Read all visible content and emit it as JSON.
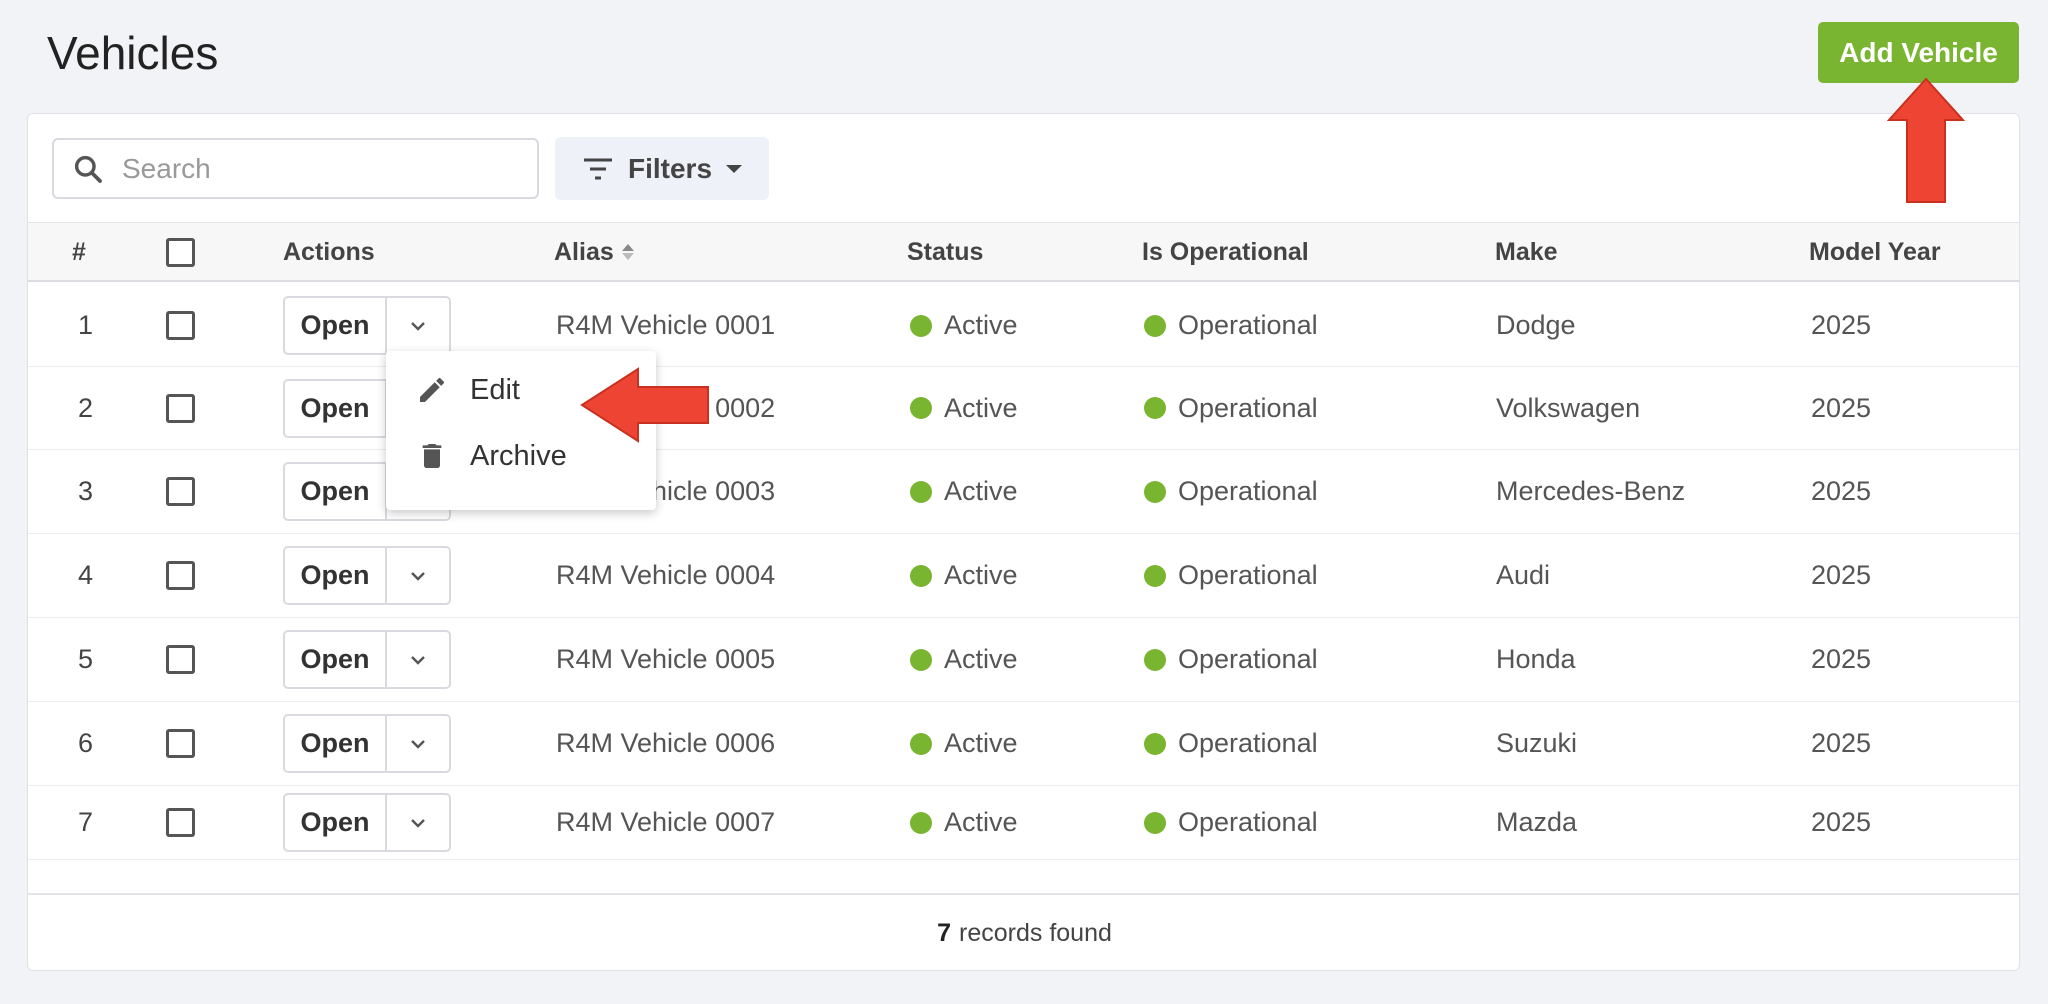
{
  "page": {
    "title": "Vehicles"
  },
  "toolbar": {
    "add_label": "Add Vehicle",
    "search_placeholder": "Search",
    "search_value": "",
    "filters_label": "Filters"
  },
  "table": {
    "headers": {
      "index": "#",
      "actions": "Actions",
      "alias": "Alias",
      "status": "Status",
      "operational": "Is Operational",
      "make": "Make",
      "model_year": "Model Year"
    },
    "rows": [
      {
        "n": "1",
        "alias": "R4M Vehicle 0001",
        "status": "Active",
        "operational": "Operational",
        "make": "Dodge",
        "year": "2025",
        "open": "Open"
      },
      {
        "n": "2",
        "alias": "R4M Vehicle 0002",
        "status": "Active",
        "operational": "Operational",
        "make": "Volkswagen",
        "year": "2025",
        "open": "Open"
      },
      {
        "n": "3",
        "alias": "R4M Vehicle 0003",
        "status": "Active",
        "operational": "Operational",
        "make": "Mercedes-Benz",
        "year": "2025",
        "open": "Open"
      },
      {
        "n": "4",
        "alias": "R4M Vehicle 0004",
        "status": "Active",
        "operational": "Operational",
        "make": "Audi",
        "year": "2025",
        "open": "Open"
      },
      {
        "n": "5",
        "alias": "R4M Vehicle 0005",
        "status": "Active",
        "operational": "Operational",
        "make": "Honda",
        "year": "2025",
        "open": "Open"
      },
      {
        "n": "6",
        "alias": "R4M Vehicle 0006",
        "status": "Active",
        "operational": "Operational",
        "make": "Suzuki",
        "year": "2025",
        "open": "Open"
      },
      {
        "n": "7",
        "alias": "R4M Vehicle 0007",
        "status": "Active",
        "operational": "Operational",
        "make": "Mazda",
        "year": "2025",
        "open": "Open"
      }
    ]
  },
  "dropdown_menu": {
    "items": [
      {
        "label": "Edit",
        "icon": "pencil-icon"
      },
      {
        "label": "Archive",
        "icon": "trash-icon"
      }
    ]
  },
  "footer": {
    "count": "7",
    "text": "records found"
  },
  "colors": {
    "accent_green": "#7ab531",
    "status_dot": "#7ab531",
    "annotation_arrow": "#ee4433"
  }
}
